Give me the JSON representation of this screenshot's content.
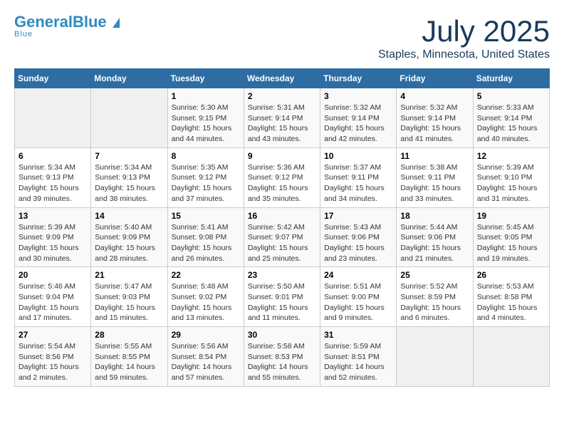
{
  "header": {
    "logo_general": "General",
    "logo_blue": "Blue",
    "title": "July 2025",
    "subtitle": "Staples, Minnesota, United States"
  },
  "calendar": {
    "weekdays": [
      "Sunday",
      "Monday",
      "Tuesday",
      "Wednesday",
      "Thursday",
      "Friday",
      "Saturday"
    ],
    "weeks": [
      [
        {
          "day": "",
          "detail": ""
        },
        {
          "day": "",
          "detail": ""
        },
        {
          "day": "1",
          "detail": "Sunrise: 5:30 AM\nSunset: 9:15 PM\nDaylight: 15 hours\nand 44 minutes."
        },
        {
          "day": "2",
          "detail": "Sunrise: 5:31 AM\nSunset: 9:14 PM\nDaylight: 15 hours\nand 43 minutes."
        },
        {
          "day": "3",
          "detail": "Sunrise: 5:32 AM\nSunset: 9:14 PM\nDaylight: 15 hours\nand 42 minutes."
        },
        {
          "day": "4",
          "detail": "Sunrise: 5:32 AM\nSunset: 9:14 PM\nDaylight: 15 hours\nand 41 minutes."
        },
        {
          "day": "5",
          "detail": "Sunrise: 5:33 AM\nSunset: 9:14 PM\nDaylight: 15 hours\nand 40 minutes."
        }
      ],
      [
        {
          "day": "6",
          "detail": "Sunrise: 5:34 AM\nSunset: 9:13 PM\nDaylight: 15 hours\nand 39 minutes."
        },
        {
          "day": "7",
          "detail": "Sunrise: 5:34 AM\nSunset: 9:13 PM\nDaylight: 15 hours\nand 38 minutes."
        },
        {
          "day": "8",
          "detail": "Sunrise: 5:35 AM\nSunset: 9:12 PM\nDaylight: 15 hours\nand 37 minutes."
        },
        {
          "day": "9",
          "detail": "Sunrise: 5:36 AM\nSunset: 9:12 PM\nDaylight: 15 hours\nand 35 minutes."
        },
        {
          "day": "10",
          "detail": "Sunrise: 5:37 AM\nSunset: 9:11 PM\nDaylight: 15 hours\nand 34 minutes."
        },
        {
          "day": "11",
          "detail": "Sunrise: 5:38 AM\nSunset: 9:11 PM\nDaylight: 15 hours\nand 33 minutes."
        },
        {
          "day": "12",
          "detail": "Sunrise: 5:39 AM\nSunset: 9:10 PM\nDaylight: 15 hours\nand 31 minutes."
        }
      ],
      [
        {
          "day": "13",
          "detail": "Sunrise: 5:39 AM\nSunset: 9:09 PM\nDaylight: 15 hours\nand 30 minutes."
        },
        {
          "day": "14",
          "detail": "Sunrise: 5:40 AM\nSunset: 9:09 PM\nDaylight: 15 hours\nand 28 minutes."
        },
        {
          "day": "15",
          "detail": "Sunrise: 5:41 AM\nSunset: 9:08 PM\nDaylight: 15 hours\nand 26 minutes."
        },
        {
          "day": "16",
          "detail": "Sunrise: 5:42 AM\nSunset: 9:07 PM\nDaylight: 15 hours\nand 25 minutes."
        },
        {
          "day": "17",
          "detail": "Sunrise: 5:43 AM\nSunset: 9:06 PM\nDaylight: 15 hours\nand 23 minutes."
        },
        {
          "day": "18",
          "detail": "Sunrise: 5:44 AM\nSunset: 9:06 PM\nDaylight: 15 hours\nand 21 minutes."
        },
        {
          "day": "19",
          "detail": "Sunrise: 5:45 AM\nSunset: 9:05 PM\nDaylight: 15 hours\nand 19 minutes."
        }
      ],
      [
        {
          "day": "20",
          "detail": "Sunrise: 5:46 AM\nSunset: 9:04 PM\nDaylight: 15 hours\nand 17 minutes."
        },
        {
          "day": "21",
          "detail": "Sunrise: 5:47 AM\nSunset: 9:03 PM\nDaylight: 15 hours\nand 15 minutes."
        },
        {
          "day": "22",
          "detail": "Sunrise: 5:48 AM\nSunset: 9:02 PM\nDaylight: 15 hours\nand 13 minutes."
        },
        {
          "day": "23",
          "detail": "Sunrise: 5:50 AM\nSunset: 9:01 PM\nDaylight: 15 hours\nand 11 minutes."
        },
        {
          "day": "24",
          "detail": "Sunrise: 5:51 AM\nSunset: 9:00 PM\nDaylight: 15 hours\nand 9 minutes."
        },
        {
          "day": "25",
          "detail": "Sunrise: 5:52 AM\nSunset: 8:59 PM\nDaylight: 15 hours\nand 6 minutes."
        },
        {
          "day": "26",
          "detail": "Sunrise: 5:53 AM\nSunset: 8:58 PM\nDaylight: 15 hours\nand 4 minutes."
        }
      ],
      [
        {
          "day": "27",
          "detail": "Sunrise: 5:54 AM\nSunset: 8:56 PM\nDaylight: 15 hours\nand 2 minutes."
        },
        {
          "day": "28",
          "detail": "Sunrise: 5:55 AM\nSunset: 8:55 PM\nDaylight: 14 hours\nand 59 minutes."
        },
        {
          "day": "29",
          "detail": "Sunrise: 5:56 AM\nSunset: 8:54 PM\nDaylight: 14 hours\nand 57 minutes."
        },
        {
          "day": "30",
          "detail": "Sunrise: 5:58 AM\nSunset: 8:53 PM\nDaylight: 14 hours\nand 55 minutes."
        },
        {
          "day": "31",
          "detail": "Sunrise: 5:59 AM\nSunset: 8:51 PM\nDaylight: 14 hours\nand 52 minutes."
        },
        {
          "day": "",
          "detail": ""
        },
        {
          "day": "",
          "detail": ""
        }
      ]
    ]
  }
}
